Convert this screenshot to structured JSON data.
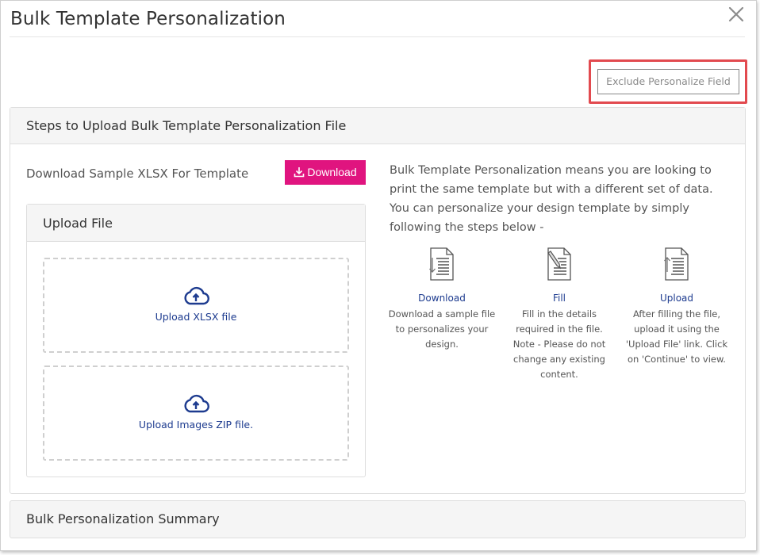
{
  "modal": {
    "title": "Bulk Template Personalization",
    "exclude_button": "Exclude Personalize Field"
  },
  "steps_panel": {
    "header": "Steps to Upload Bulk Template Personalization File",
    "sample_label": "Download Sample XLSX For Template",
    "download_button": "Download",
    "intro": "Bulk Template Personalization means you are looking to print the same template but with a different set of data. You can personalize your design template by simply following the steps below -",
    "steps": [
      {
        "title": "Download",
        "desc": "Download a sample file to personalizes your design.",
        "icon": "download-doc-icon"
      },
      {
        "title": "Fill",
        "desc": "Fill in the details required in the file. Note - Please do not change any existing content.",
        "icon": "fill-doc-icon"
      },
      {
        "title": "Upload",
        "desc": "After filling the file, upload it using the 'Upload File' link. Click on 'Continue' to view.",
        "icon": "upload-doc-icon"
      }
    ]
  },
  "upload_card": {
    "header": "Upload File",
    "xlsx_label": "Upload XLSX file",
    "zip_label": "Upload Images ZIP file."
  },
  "summary": {
    "header": "Bulk Personalization Summary"
  },
  "colors": {
    "accent": "#e0147f",
    "link": "#1d3b8f",
    "highlight": "#e24a4f"
  }
}
